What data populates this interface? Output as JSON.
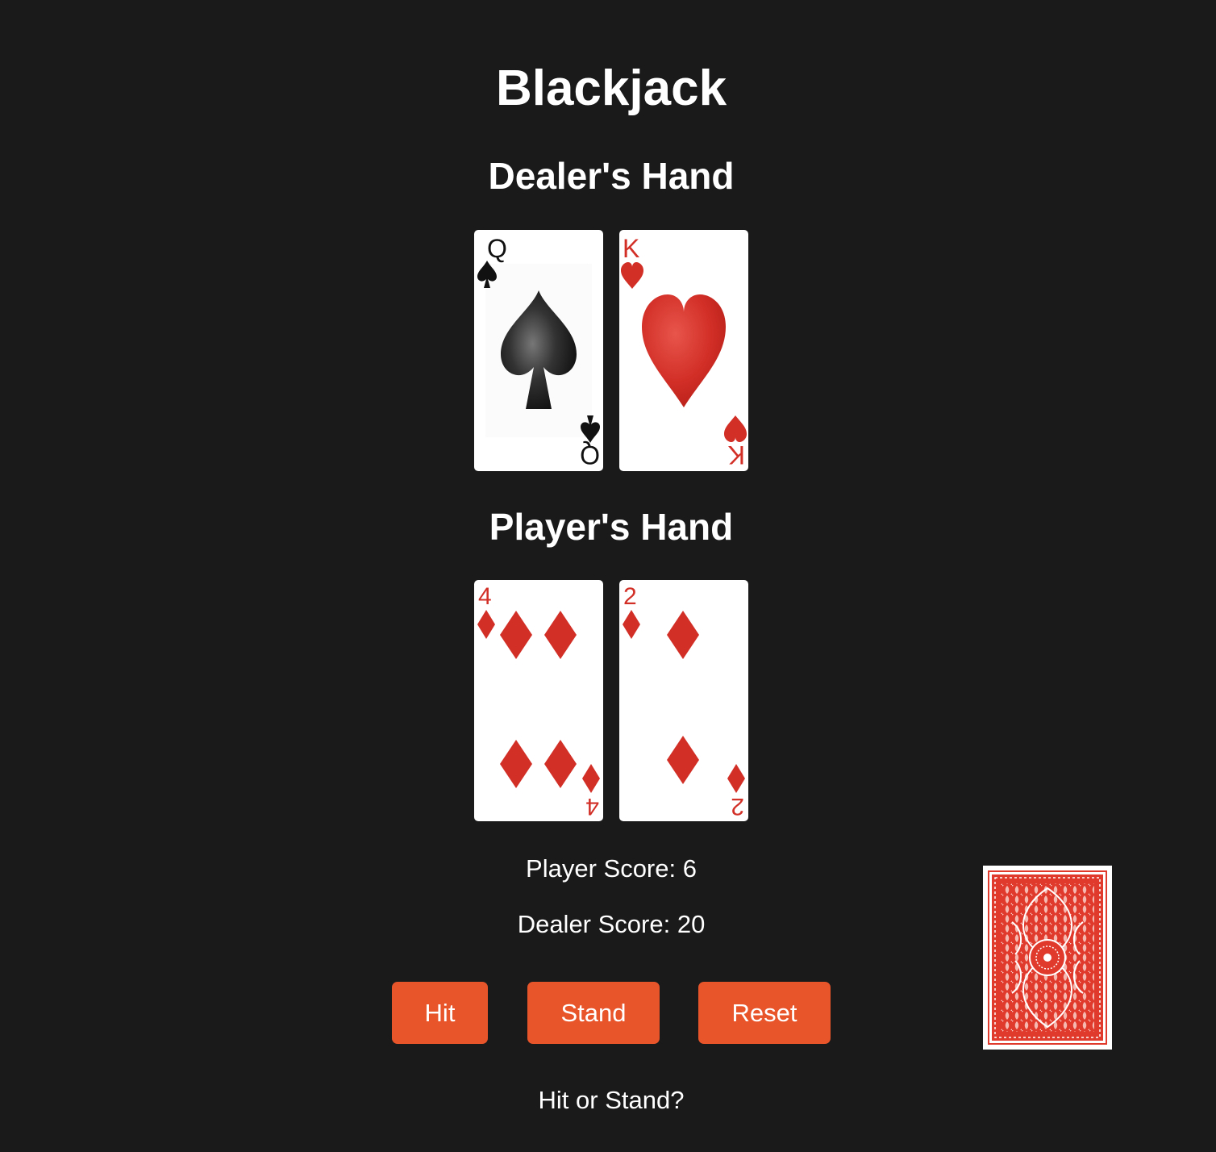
{
  "game": {
    "title": "Blackjack",
    "dealer_heading": "Dealer's Hand",
    "player_heading": "Player's Hand",
    "player_score_text": "Player Score: 6",
    "dealer_score_text": "Dealer Score: 20",
    "status_message": "Hit or Stand?"
  },
  "dealer_hand": [
    {
      "rank": "Q",
      "suit": "spades"
    },
    {
      "rank": "K",
      "suit": "hearts"
    }
  ],
  "player_hand": [
    {
      "rank": "4",
      "suit": "diamonds"
    },
    {
      "rank": "2",
      "suit": "diamonds"
    }
  ],
  "controls": {
    "hit_label": "Hit",
    "stand_label": "Stand",
    "reset_label": "Reset"
  },
  "deck": {
    "icon": "card-back-icon"
  },
  "colors": {
    "background": "#1a1a1a",
    "button": "#e8552b",
    "red_suit": "#d22f27",
    "black_suit": "#111111",
    "card_back": "#e03a2c"
  }
}
